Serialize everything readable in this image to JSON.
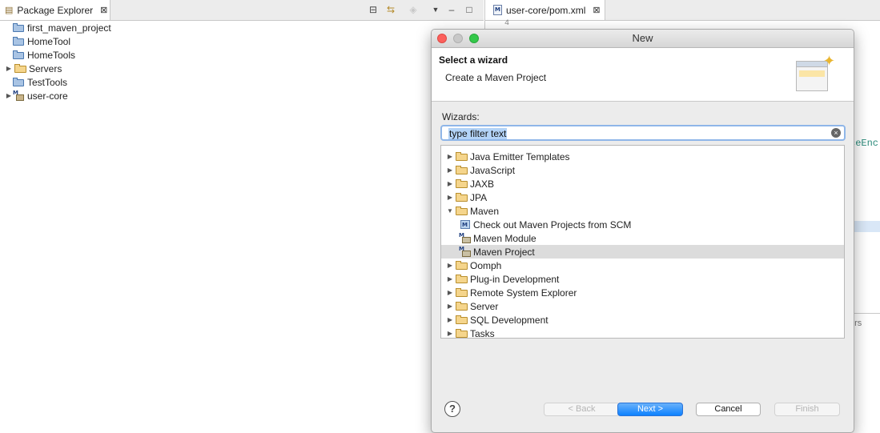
{
  "package_explorer": {
    "tab_title": "Package Explorer",
    "close_glyph": "⊠",
    "tree": [
      {
        "label": "first_maven_project",
        "icon": "project-folder-icon",
        "expandable": false
      },
      {
        "label": "HomeTool",
        "icon": "project-folder-icon",
        "expandable": false
      },
      {
        "label": "HomeTools",
        "icon": "project-folder-icon",
        "expandable": false
      },
      {
        "label": "Servers",
        "icon": "open-folder-icon",
        "expandable": true
      },
      {
        "label": "TestTools",
        "icon": "project-folder-icon",
        "expandable": false
      },
      {
        "label": "user-core",
        "icon": "maven-project-icon",
        "expandable": true
      }
    ]
  },
  "editor": {
    "tab_title": "user-core/pom.xml",
    "close_glyph": "⊠",
    "line_number": "4",
    "code_fragment": "ceEnc",
    "console_fragment": "ers"
  },
  "dialog": {
    "title": "New",
    "banner_title": "Select a wizard",
    "banner_description": "Create a Maven Project",
    "wizards_label": "Wizards:",
    "filter_placeholder": "type filter text",
    "clear_glyph": "×",
    "items": [
      {
        "label": "Java Emitter Templates",
        "kind": "folder",
        "expanded": false
      },
      {
        "label": "JavaScript",
        "kind": "folder",
        "expanded": false
      },
      {
        "label": "JAXB",
        "kind": "folder",
        "expanded": false
      },
      {
        "label": "JPA",
        "kind": "folder",
        "expanded": false
      },
      {
        "label": "Maven",
        "kind": "folder",
        "expanded": true
      },
      {
        "label": "Check out Maven Projects from SCM",
        "kind": "leaf",
        "icon": "scm-checkout-icon"
      },
      {
        "label": "Maven Module",
        "kind": "leaf",
        "icon": "maven-module-icon"
      },
      {
        "label": "Maven Project",
        "kind": "leaf",
        "icon": "maven-project-icon",
        "selected": true
      },
      {
        "label": "Oomph",
        "kind": "folder",
        "expanded": false
      },
      {
        "label": "Plug-in Development",
        "kind": "folder",
        "expanded": false
      },
      {
        "label": "Remote System Explorer",
        "kind": "folder",
        "expanded": false
      },
      {
        "label": "Server",
        "kind": "folder",
        "expanded": false
      },
      {
        "label": "SQL Development",
        "kind": "folder",
        "expanded": false
      },
      {
        "label": "Tasks",
        "kind": "folder",
        "expanded": false
      }
    ],
    "buttons": {
      "help": "?",
      "back": "< Back",
      "next": "Next >",
      "cancel": "Cancel",
      "finish": "Finish"
    }
  }
}
